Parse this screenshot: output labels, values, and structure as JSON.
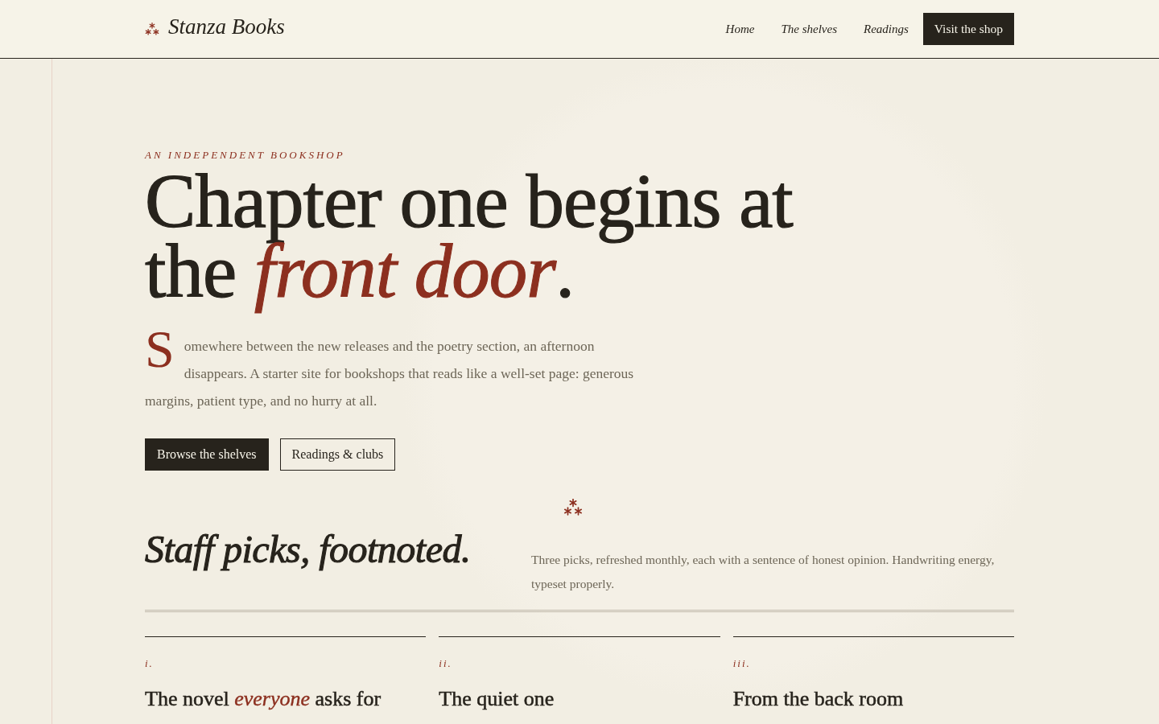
{
  "header": {
    "brand": "Stanza Books",
    "nav": [
      {
        "label": "Home"
      },
      {
        "label": "The shelves"
      },
      {
        "label": "Readings"
      }
    ],
    "cta": "Visit the shop"
  },
  "hero": {
    "eyebrow": "AN INDEPENDENT BOOKSHOP",
    "heading": "Chapter one begins at the *front door*.",
    "intro": "Somewhere between the new releases and the poetry section, an afternoon disappears. A starter site for bookshops that reads like a well-set page: generous margins, patient type, and no hurry at all.",
    "buttons": [
      {
        "label": "Browse the shelves",
        "kind": "primary"
      },
      {
        "label": "Readings & clubs",
        "kind": "secondary"
      }
    ]
  },
  "staff_picks": {
    "heading": "Staff picks, footnoted.",
    "description": "Three picks, refreshed monthly, each with a sentence of honest opinion. Handwriting energy, typeset properly.",
    "picks": [
      {
        "numeral": "i.",
        "title": "The novel *everyone* asks for"
      },
      {
        "numeral": "ii.",
        "title": "The quiet one"
      },
      {
        "numeral": "iii.",
        "title": "From the back room"
      }
    ]
  }
}
